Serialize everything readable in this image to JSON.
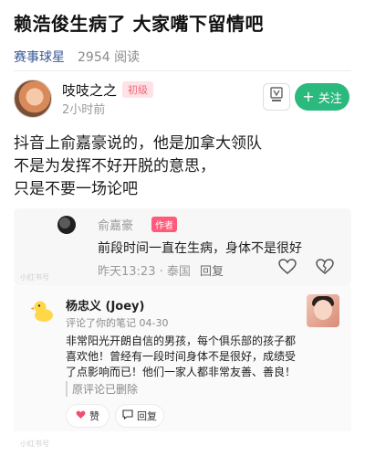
{
  "article": {
    "title": "赖浩俊生病了 大家嘴下留情吧",
    "channel": "赛事球星",
    "reads": "2954 阅读"
  },
  "author": {
    "name": "吱吱之之",
    "level": "初级",
    "time": "2小时前",
    "follow_label": "关注"
  },
  "body": {
    "lines": [
      "抖音上俞嘉豪说的，他是加拿大领队",
      "不是为发挥不好开脱的意思，",
      "只是不要一场论吧"
    ]
  },
  "comment1": {
    "name": "俞嘉豪",
    "author_badge": "作者",
    "text": "前段时间一直在生病，身体不是很好",
    "time": "昨天13:23 · 泰国",
    "reply_label": "回复",
    "watermark": "小红书号"
  },
  "comment2": {
    "name": "杨忠义 (Joey)",
    "sub": "评论了你的笔记 04-30",
    "lines": [
      "非常阳光开朗自信的男孩，每个俱乐部的孩子都",
      "喜欢他！曾经有一段时间身体不是很好，成绩受",
      "了点影响而已！他们一家人都非常友善、善良！"
    ],
    "deleted": "原评论已删除",
    "like_label": "赞",
    "reply_label": "回复",
    "watermark": "小红书号"
  },
  "colors": {
    "follow": "#2bb97d",
    "author_badge": "#ff5a7a",
    "level_badge_text": "#f0677a",
    "channel_link": "#3a5a98"
  }
}
